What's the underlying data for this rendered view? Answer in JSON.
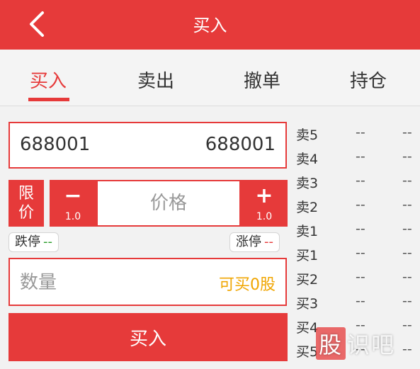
{
  "header": {
    "title": "买入"
  },
  "tabs": [
    {
      "label": "买入",
      "active": true
    },
    {
      "label": "卖出",
      "active": false
    },
    {
      "label": "撤单",
      "active": false
    },
    {
      "label": "持仓",
      "active": false
    }
  ],
  "stock": {
    "code": "688001",
    "code_right": "688001"
  },
  "order_type": {
    "line1": "限",
    "line2": "价"
  },
  "price": {
    "placeholder": "价格",
    "minus": "−",
    "plus": "+",
    "minus_step": "1.0",
    "plus_step": "1.0"
  },
  "limits": {
    "down_label": "跌停",
    "down_value": "--",
    "up_label": "涨停",
    "up_value": "--"
  },
  "quantity": {
    "placeholder": "数量",
    "available": "可买0股"
  },
  "buy_button": "买入",
  "order_book": [
    {
      "label": "卖5",
      "price": "--",
      "qty": "--"
    },
    {
      "label": "卖4",
      "price": "--",
      "qty": "--"
    },
    {
      "label": "卖3",
      "price": "--",
      "qty": "--"
    },
    {
      "label": "卖2",
      "price": "--",
      "qty": "--"
    },
    {
      "label": "卖1",
      "price": "--",
      "qty": "--"
    },
    {
      "label": "买1",
      "price": "--",
      "qty": "--"
    },
    {
      "label": "买2",
      "price": "--",
      "qty": "--"
    },
    {
      "label": "买3",
      "price": "--",
      "qty": "--"
    },
    {
      "label": "买4",
      "price": "--",
      "qty": "--"
    },
    {
      "label": "买5",
      "price": "--",
      "qty": "--"
    }
  ],
  "watermark": {
    "char1": "股",
    "rest": "识吧"
  },
  "colors": {
    "accent": "#e63a3a",
    "available": "#f0a500",
    "down": "#2a9d2a"
  }
}
